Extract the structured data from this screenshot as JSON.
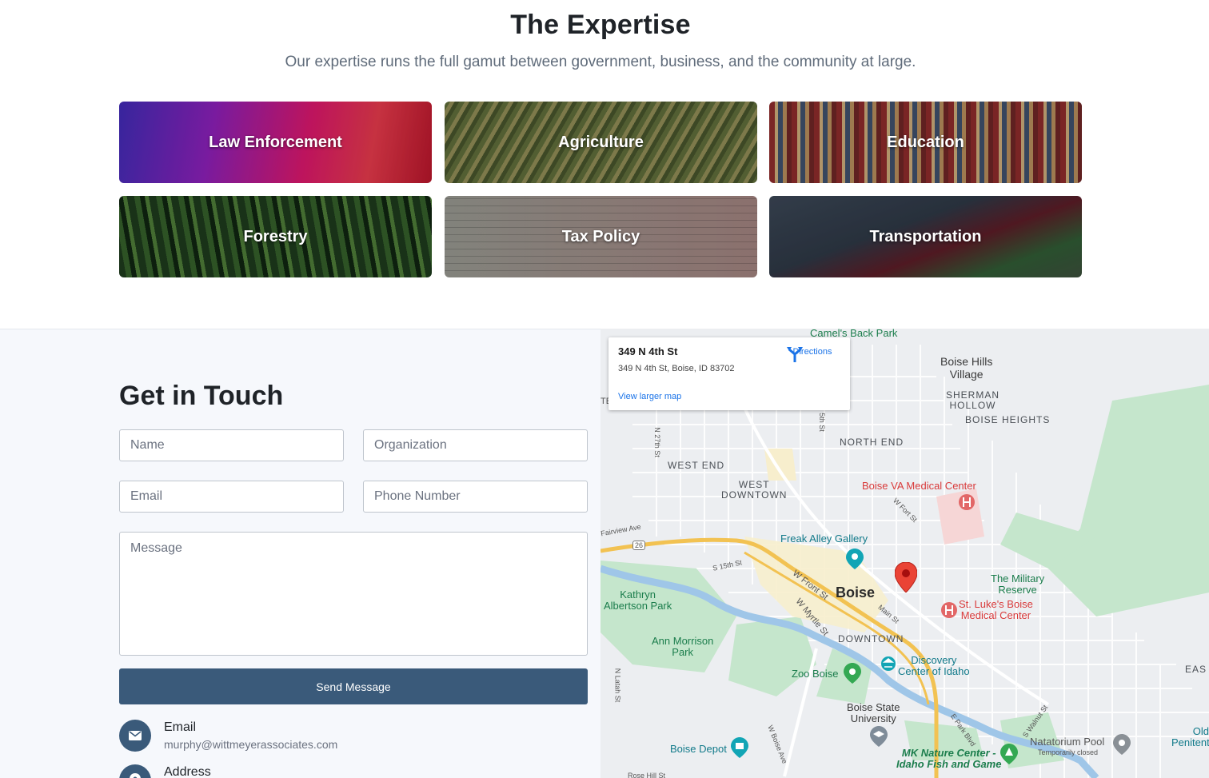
{
  "expertise": {
    "title": "The Expertise",
    "subtitle": "Our expertise runs the full gamut between government, business, and the community at large.",
    "tiles": [
      {
        "label": "Law Enforcement"
      },
      {
        "label": "Agriculture"
      },
      {
        "label": "Education"
      },
      {
        "label": "Forestry"
      },
      {
        "label": "Tax Policy"
      },
      {
        "label": "Transportation"
      }
    ]
  },
  "contact": {
    "title": "Get in Touch",
    "form": {
      "name_placeholder": "Name",
      "organization_placeholder": "Organization",
      "email_placeholder": "Email",
      "phone_placeholder": "Phone Number",
      "message_placeholder": "Message",
      "send_label": "Send Message"
    },
    "info": {
      "email_label": "Email",
      "email_value": "murphy@wittmeyerassociates.com",
      "address_label": "Address"
    }
  },
  "map": {
    "card": {
      "title": "349 N 4th St",
      "address": "349 N 4th St, Boise, ID 83702",
      "directions": "Directions",
      "larger_map": "View larger map"
    },
    "labels": {
      "camels_back": "Camel's Back Park",
      "boise_hills": "Boise Hills\nVillage",
      "sherman_hollow": "SHERMAN\nHOLLOW",
      "boise_heights": "BOISE HEIGHTS",
      "north_end": "NORTH END",
      "west_end": "WEST END",
      "west_downtown": "WEST\nDOWNTOWN",
      "va_center": "Boise VA Medical Center",
      "freak_alley": "Freak Alley Gallery",
      "boise": "Boise",
      "military_reserve": "The Military\nReserve",
      "st_lukes": "St. Luke's Boise\nMedical Center",
      "kathryn": "Kathryn\nAlbertson Park",
      "ann_morrison": "Ann Morrison\nPark",
      "downtown": "DOWNTOWN",
      "discovery": "Discovery\nCenter of Idaho",
      "zoo_boise": "Zoo Boise",
      "bsu": "Boise State\nUniversity",
      "boise_depot": "Boise Depot",
      "mk_nature": "MK Nature Center -\nIdaho Fish and Game",
      "natatorium": "Natatorium Pool",
      "temp_closed": "Temporarily closed",
      "old_ida": "Old Ida\nPenitentiary",
      "east": "EAS",
      "fairview": "Fairview Ave",
      "hwy26": "26",
      "s15th": "S 15th St",
      "wfront": "W Front St",
      "wmyrtle": "W Myrtle St",
      "main": "Main St",
      "wfort": "W Fort St",
      "n27th": "N 27th St",
      "s5th": "5th St",
      "nlatah": "N Latah St",
      "epark": "E Park Blvd",
      "swalnut": "S Walnut St",
      "wboise": "W Boise Ave",
      "rosehill": "Rose Hill St",
      "te": "TE"
    }
  }
}
